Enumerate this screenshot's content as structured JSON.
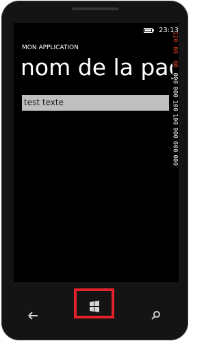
{
  "status_bar": {
    "time": "23:13",
    "icons": [
      "battery-icon"
    ]
  },
  "app": {
    "title": "MON APPLICATION",
    "page_title": "nom de la page"
  },
  "text_field": {
    "value": "test texte"
  },
  "frame_counter": {
    "values": [
      "120",
      "00",
      "00",
      "000",
      "000",
      "100",
      "100",
      "000",
      "000",
      "000"
    ],
    "highlight_color": "#e0402a",
    "text_color": "#ffffff"
  },
  "nav_bar": {
    "buttons": [
      {
        "name": "back",
        "icon": "back-arrow-icon"
      },
      {
        "name": "start",
        "icon": "windows-logo-icon"
      },
      {
        "name": "search",
        "icon": "search-icon"
      }
    ],
    "highlight_color": "#e3222c"
  }
}
